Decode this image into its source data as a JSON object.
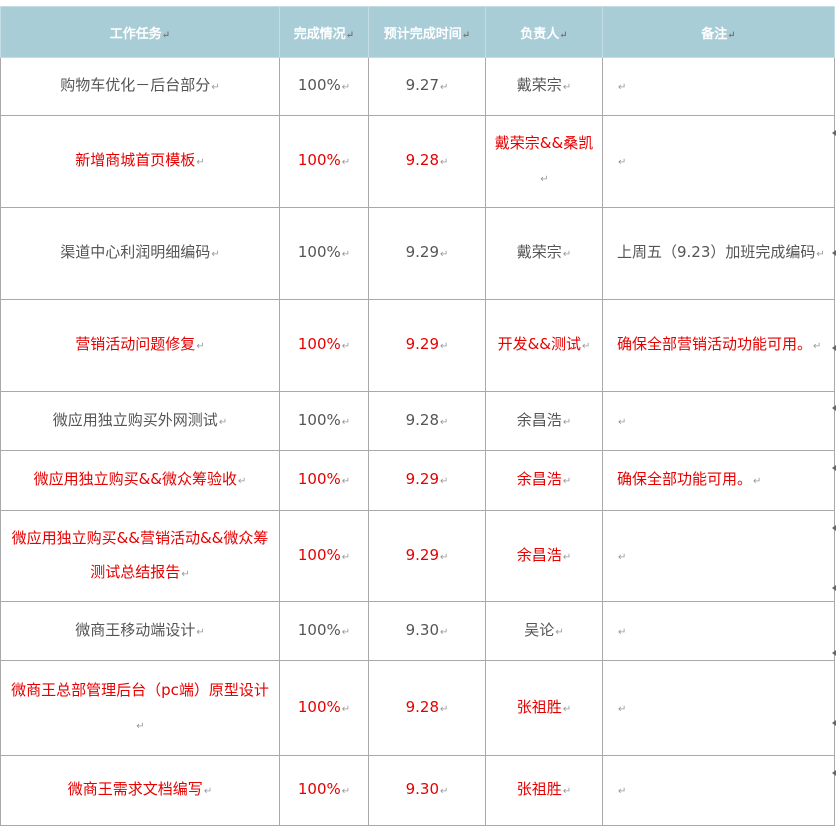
{
  "header": {
    "task": "工作任务",
    "status": "完成情况",
    "due": "预计完成时间",
    "owner": "负责人",
    "note": "备注",
    "para_mark": "↵"
  },
  "rows": [
    {
      "task": "购物车优化－后台部分",
      "status": "100%",
      "due": "9.27",
      "owner": "戴荣宗",
      "note": "",
      "highlight": false
    },
    {
      "task": "新增商城首页模板",
      "status": "100%",
      "due": "9.28",
      "owner": "戴荣宗&&桑凯",
      "note": "",
      "highlight": true
    },
    {
      "task": "渠道中心利润明细编码",
      "status": "100%",
      "due": "9.29",
      "owner": "戴荣宗",
      "note": "上周五（9.23）加班完成编码",
      "highlight": false
    },
    {
      "task": "营销活动问题修复",
      "status": "100%",
      "due": "9.29",
      "owner": "开发&&测试",
      "note": "确保全部营销活动功能可用。",
      "highlight": true
    },
    {
      "task": "微应用独立购买外网测试",
      "status": "100%",
      "due": "9.28",
      "owner": "余昌浩",
      "note": "",
      "highlight": false
    },
    {
      "task": "微应用独立购买&&微众筹验收",
      "status": "100%",
      "due": "9.29",
      "owner": "余昌浩",
      "note": "确保全部功能可用。",
      "highlight": true
    },
    {
      "task": "微应用独立购买&&营销活动&&微众筹 测试总结报告",
      "status": "100%",
      "due": "9.29",
      "owner": "余昌浩",
      "note": "",
      "highlight": true
    },
    {
      "task": "微商王移动端设计",
      "status": "100%",
      "due": "9.30",
      "owner": "吴论",
      "note": "",
      "highlight": false
    },
    {
      "task": "微商王总部管理后台（pc端）原型设计",
      "status": "100%",
      "due": "9.28",
      "owner": "张祖胜",
      "note": "",
      "highlight": true
    },
    {
      "task": "微商王需求文档编写",
      "status": "100%",
      "due": "9.30",
      "owner": "张祖胜",
      "note": "",
      "highlight": true
    }
  ],
  "colors": {
    "header_bg": "#a9cdd7",
    "header_text": "#ffffff",
    "body_text": "#555555",
    "highlight_text": "#e60000",
    "grid": "#a9a9a9"
  }
}
